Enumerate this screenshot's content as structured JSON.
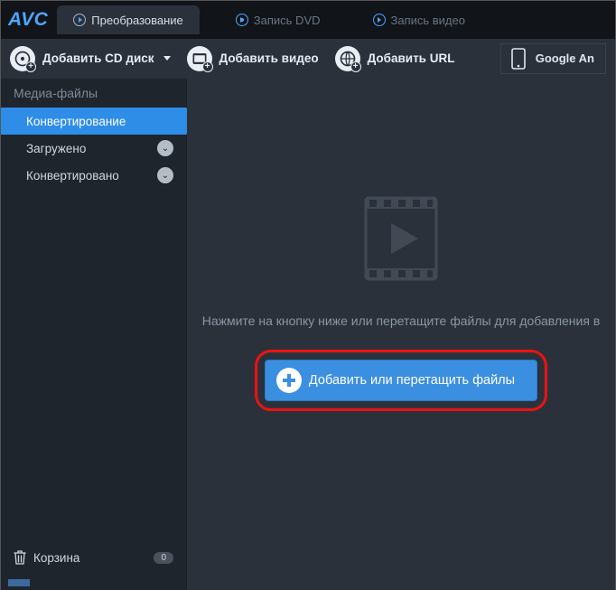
{
  "logo": "AVC",
  "tabs": [
    {
      "label": "Преобразование"
    },
    {
      "label": "Запись DVD"
    },
    {
      "label": "Запись видео"
    }
  ],
  "toolbar": {
    "add_cd": "Добавить CD диск",
    "add_video": "Добавить видео",
    "add_url": "Добавить URL",
    "device": "Google An"
  },
  "sidebar": {
    "header": "Медиа-файлы",
    "items": [
      {
        "label": "Конвертирование"
      },
      {
        "label": "Загружено"
      },
      {
        "label": "Конвертировано"
      }
    ],
    "trash": "Корзина",
    "trash_count": "0"
  },
  "content": {
    "hint": "Нажмите на кнопку ниже или перетащите файлы для добавления в",
    "add_button": "Добавить или перетащить файлы"
  }
}
